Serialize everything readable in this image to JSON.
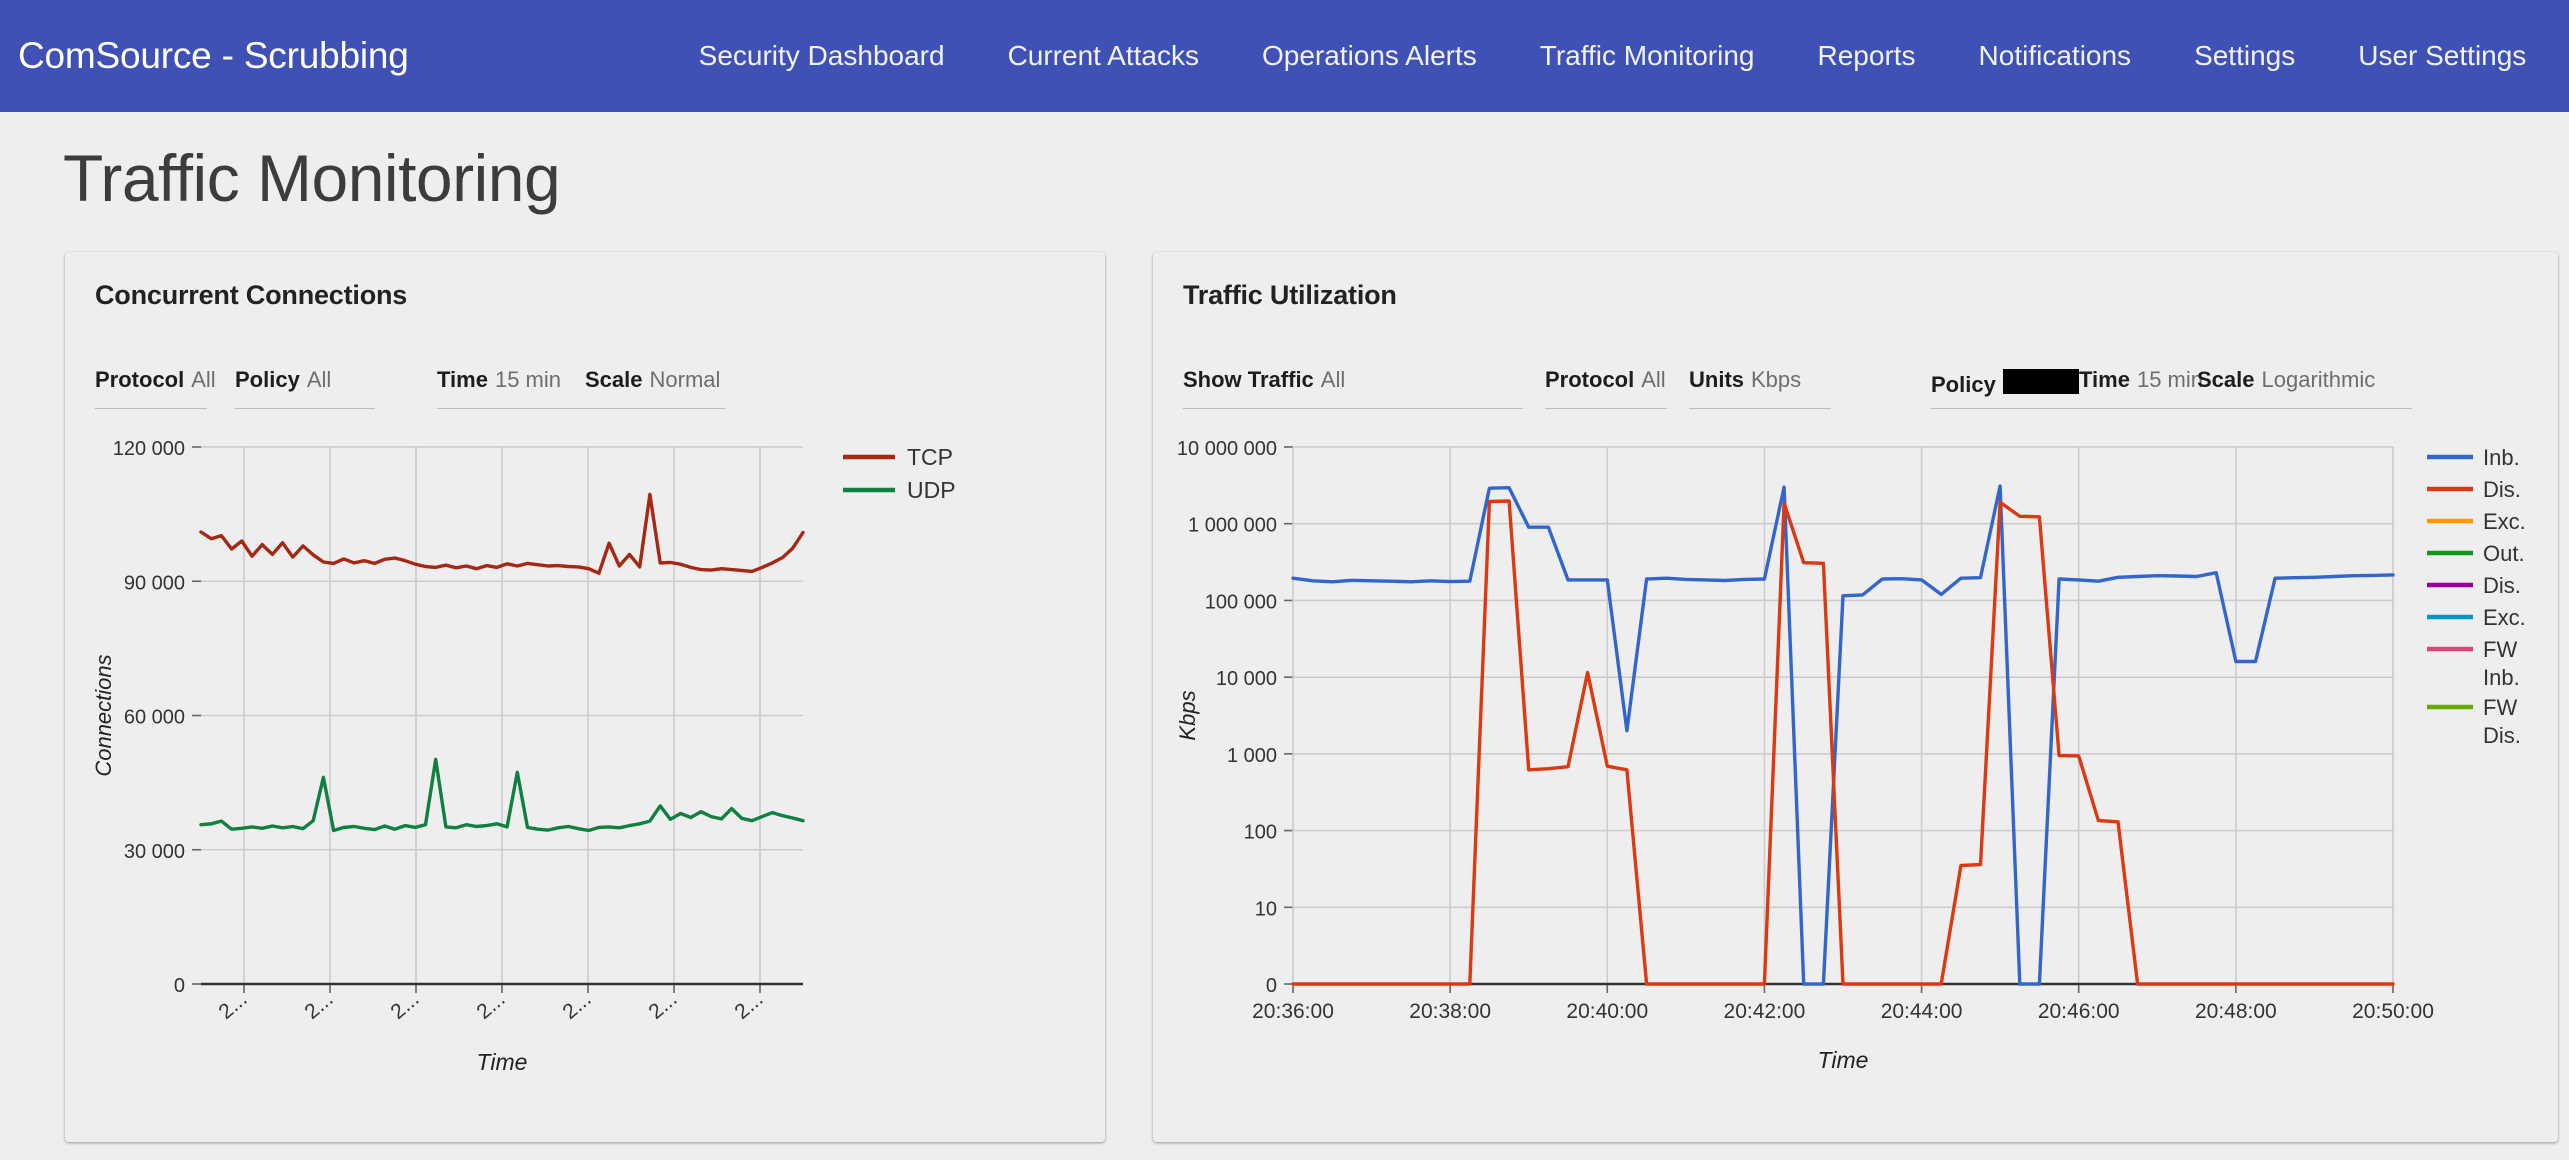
{
  "navbar": {
    "brand": "ComSource - Scrubbing",
    "links": [
      {
        "label": "Security Dashboard"
      },
      {
        "label": "Current Attacks"
      },
      {
        "label": "Operations Alerts"
      },
      {
        "label": "Traffic Monitoring"
      },
      {
        "label": "Reports"
      },
      {
        "label": "Notifications"
      },
      {
        "label": "Settings"
      },
      {
        "label": "User Settings"
      }
    ],
    "bg_color": "#3f51b5",
    "text_color": "#ffffff"
  },
  "page": {
    "title": "Traffic Monitoring",
    "background": "#eeeeee"
  },
  "cards": {
    "connections": {
      "title": "Concurrent Connections",
      "controls": {
        "protocol_label": "Protocol",
        "protocol_value": "All",
        "policy_label": "Policy",
        "policy_value": "All",
        "time_label": "Time",
        "time_value": "15 min",
        "scale_label": "Scale",
        "scale_value": "Normal"
      }
    },
    "utilization": {
      "title": "Traffic Utilization",
      "controls": {
        "show_traffic_label": "Show Traffic",
        "show_traffic_value": "All",
        "protocol_label": "Protocol",
        "protocol_value": "All",
        "units_label": "Units",
        "units_value": "Kbps",
        "policy_label": "Policy",
        "policy_value": "",
        "policy_redacted": true,
        "time_label": "Time",
        "time_value": "15 min",
        "scale_label": "Scale",
        "scale_value": "Logarithmic"
      }
    }
  },
  "chart_data": [
    {
      "type": "line",
      "id": "concurrent-connections",
      "title": "Concurrent Connections",
      "xlabel": "Time",
      "ylabel": "Connections",
      "grid": true,
      "legend_position": "right",
      "yticks": [
        0,
        30000,
        60000,
        90000,
        120000
      ],
      "ytick_labels": [
        "0",
        "30 000",
        "60 000",
        "90 000",
        "120 000"
      ],
      "ylim": [
        0,
        120000
      ],
      "xtick_labels": [
        "2...",
        "2...",
        "2...",
        "2...",
        "2...",
        "2...",
        "2..."
      ],
      "xtick_rotated": true,
      "x_count": 60,
      "series": [
        {
          "name": "TCP",
          "color": "#a52714",
          "values": [
            101000,
            99500,
            100200,
            97200,
            99000,
            95600,
            98200,
            96000,
            98600,
            95400,
            97900,
            95900,
            94300,
            94000,
            95000,
            94100,
            94600,
            94000,
            94900,
            95200,
            94600,
            93800,
            93300,
            93100,
            93600,
            93000,
            93400,
            92800,
            93500,
            93100,
            93900,
            93400,
            94000,
            93700,
            93400,
            93500,
            93300,
            93200,
            92800,
            91800,
            98500,
            93400,
            96000,
            93200,
            109400,
            94100,
            94200,
            93800,
            93100,
            92600,
            92500,
            92800,
            92600,
            92400,
            92200,
            93100,
            94100,
            95300,
            97400,
            100900
          ]
        },
        {
          "name": "UDP",
          "color": "#0f8040",
          "values": [
            35600,
            35800,
            36400,
            34600,
            34800,
            35100,
            34800,
            35300,
            34900,
            35200,
            34700,
            36500,
            46200,
            34300,
            35000,
            35200,
            34800,
            34500,
            35300,
            34600,
            35400,
            35000,
            35600,
            50200,
            35100,
            34900,
            35600,
            35200,
            35400,
            35800,
            35100,
            47300,
            35000,
            34600,
            34400,
            34900,
            35200,
            34700,
            34300,
            35000,
            35100,
            34900,
            35400,
            35800,
            36400,
            39800,
            36800,
            38100,
            37200,
            38500,
            37400,
            36900,
            39200,
            37000,
            36500,
            37400,
            38300,
            37600,
            37100,
            36500
          ]
        }
      ]
    },
    {
      "type": "line",
      "id": "traffic-utilization",
      "title": "Traffic Utilization",
      "xlabel": "Time",
      "ylabel": "Kbps",
      "grid": true,
      "scale": "logarithmic",
      "legend_position": "right",
      "yticks": [
        0,
        10,
        100,
        1000,
        10000,
        100000,
        1000000,
        10000000
      ],
      "ytick_labels": [
        "0",
        "10",
        "100",
        "1 000",
        "10 000",
        "100 000",
        "1 000 000",
        "10 000 000"
      ],
      "xtick_labels": [
        "20:36:00",
        "20:38:00",
        "20:40:00",
        "20:42:00",
        "20:44:00",
        "20:46:00",
        "20:48:00",
        "20:50:00"
      ],
      "xlim": [
        "20:36:00",
        "20:50:00"
      ],
      "x_count": 57,
      "legend_entries": [
        {
          "name": "Inb.",
          "color": "#3366cc"
        },
        {
          "name": "Dis.",
          "color": "#dc3912"
        },
        {
          "name": "Exc.",
          "color": "#ff9900"
        },
        {
          "name": "Out.",
          "color": "#109618"
        },
        {
          "name": "Dis.",
          "color": "#990099"
        },
        {
          "name": "Exc.",
          "color": "#0099c6"
        },
        {
          "name": "FW Inb.",
          "color": "#dd4477"
        },
        {
          "name": "FW Dis.",
          "color": "#66aa00"
        }
      ],
      "series": [
        {
          "name": "Inb.",
          "color": "#3366cc",
          "values": [
            195000,
            180000,
            175000,
            183000,
            180000,
            178000,
            175000,
            180000,
            176000,
            178000,
            2900000,
            2950000,
            900000,
            900000,
            185000,
            185000,
            185000,
            2000,
            190000,
            195000,
            188000,
            185000,
            182000,
            188000,
            190000,
            3000000,
            0,
            0,
            115000,
            118000,
            190000,
            192000,
            185000,
            120000,
            195000,
            198000,
            3100000,
            0,
            0,
            190000,
            185000,
            178000,
            200000,
            205000,
            210000,
            208000,
            205000,
            230000,
            16000,
            16000,
            195000,
            198000,
            200000,
            205000,
            210000,
            212000,
            215000
          ]
        },
        {
          "name": "Dis.",
          "color": "#dc3912",
          "values": [
            0,
            0,
            0,
            0,
            0,
            0,
            0,
            0,
            0,
            0,
            1950000,
            1980000,
            620,
            640,
            680,
            11500,
            690,
            620,
            0,
            0,
            0,
            0,
            0,
            0,
            0,
            1850000,
            310000,
            305000,
            0,
            0,
            0,
            0,
            0,
            0,
            35,
            36,
            1900000,
            1250000,
            1230000,
            950,
            940,
            135,
            130,
            0,
            0,
            0,
            0,
            0,
            0,
            0,
            0,
            0,
            0,
            0,
            0,
            0,
            0
          ]
        }
      ]
    }
  ]
}
